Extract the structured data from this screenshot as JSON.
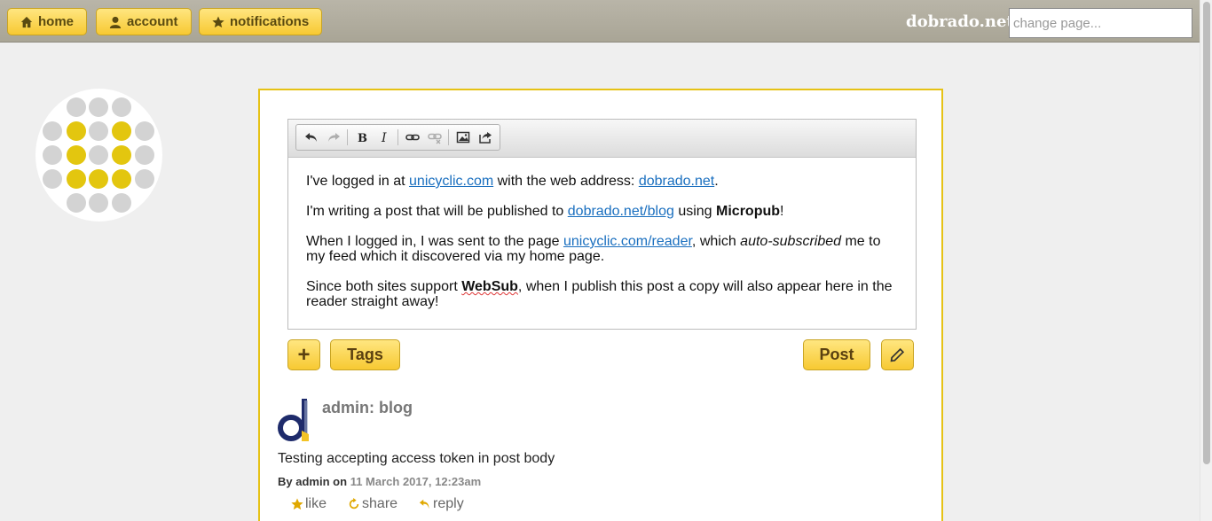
{
  "nav": {
    "home": "home",
    "account": "account",
    "notifications": "notifications",
    "site_name": "dobrado.net",
    "change_page_placeholder": "change page..."
  },
  "editor": {
    "toolbar": [
      "undo-icon",
      "redo-icon",
      "bold-icon",
      "italic-icon",
      "link-icon",
      "unlink-icon",
      "image-icon",
      "share-icon"
    ],
    "p1": {
      "pre": "I've logged in at ",
      "link1": "unicyclic.com",
      "mid": " with the web address: ",
      "link2": "dobrado.net",
      "post": "."
    },
    "p2": {
      "pre": "I'm writing a post that will be published to ",
      "link": "dobrado.net/blog",
      "mid": " using ",
      "bold": "Micropub",
      "post": "!"
    },
    "p3": {
      "pre": "When I logged in, I was sent to the page ",
      "link": "unicyclic.com/reader",
      "mid": ", which ",
      "italic": "auto-subscribed",
      "post": " me to my feed which it discovered via my home page."
    },
    "p4": {
      "pre": "Since both sites support ",
      "bold": "WebSub",
      "post": ", when I publish this post a copy will also appear here in the reader straight away!"
    }
  },
  "buttons": {
    "add": "+",
    "tags": "Tags",
    "post": "Post"
  },
  "post": {
    "title": "admin: blog",
    "body": "Testing accepting access token in post body",
    "by_label": "By",
    "author": "admin",
    "on_label": "on",
    "date": "11 March 2017, 12:23am",
    "like": "like",
    "share": "share",
    "reply": "reply"
  },
  "colors": {
    "accent": "#f7c932",
    "panel_border": "#e6c215",
    "link": "#1a6fbf"
  }
}
